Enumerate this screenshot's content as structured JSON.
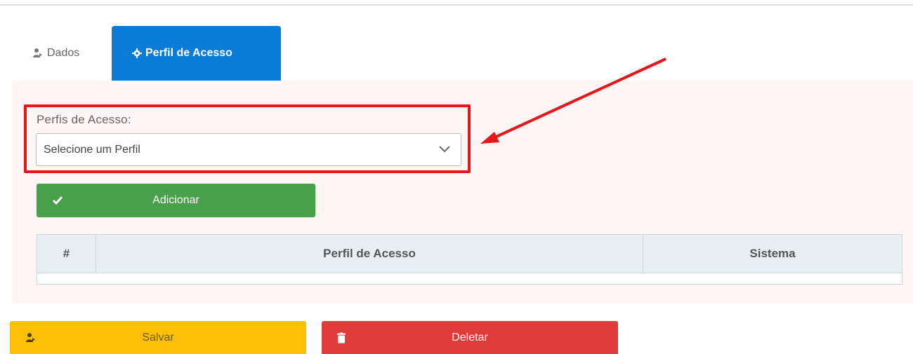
{
  "tabs": [
    {
      "label": "Dados",
      "icon": "user-icon",
      "active": false
    },
    {
      "label": "Perfil de Acesso",
      "icon": "gear-icon",
      "active": true
    }
  ],
  "form": {
    "profiles_label": "Perfis de Acesso:",
    "profile_select_value": "Selecione um Perfil"
  },
  "actions": {
    "add_label": "Adicionar",
    "save_label": "Salvar",
    "delete_label": "Deletar"
  },
  "table": {
    "headers": [
      "#",
      "Perfil de Acesso",
      "Sistema"
    ],
    "rows": []
  },
  "colors": {
    "tab_active": "#0a7bd6",
    "add_button": "#4aa04a",
    "save_button": "#fbbf06",
    "delete_button": "#e23c3a",
    "annotation": "#e8151b"
  }
}
